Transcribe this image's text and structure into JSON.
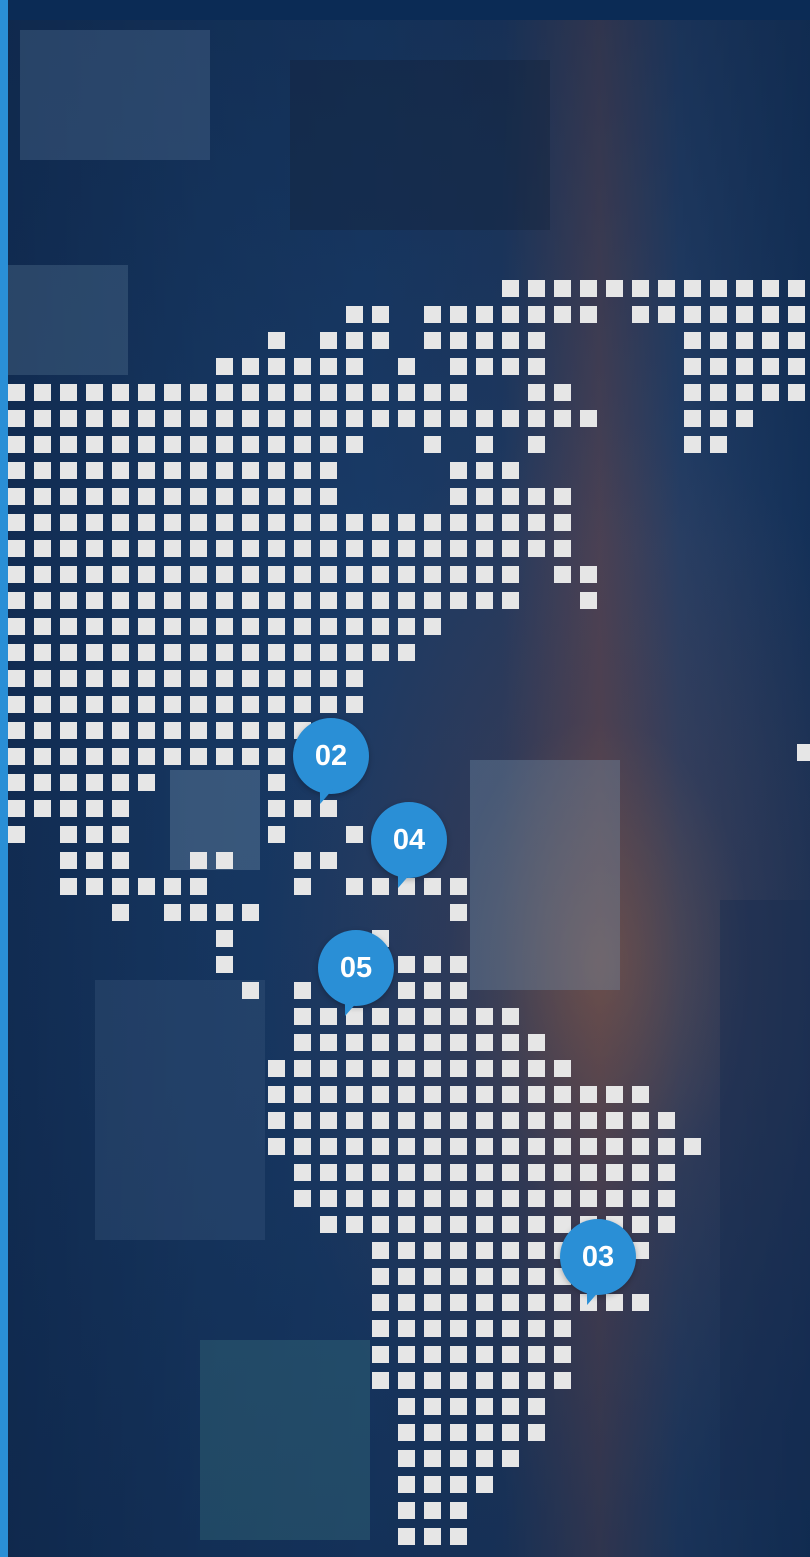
{
  "map": {
    "accent": "#2a8fd6",
    "dot_color": "#e6e6e6",
    "markers": [
      {
        "label": "02"
      },
      {
        "label": "04"
      },
      {
        "label": "05"
      },
      {
        "label": "03"
      }
    ]
  }
}
